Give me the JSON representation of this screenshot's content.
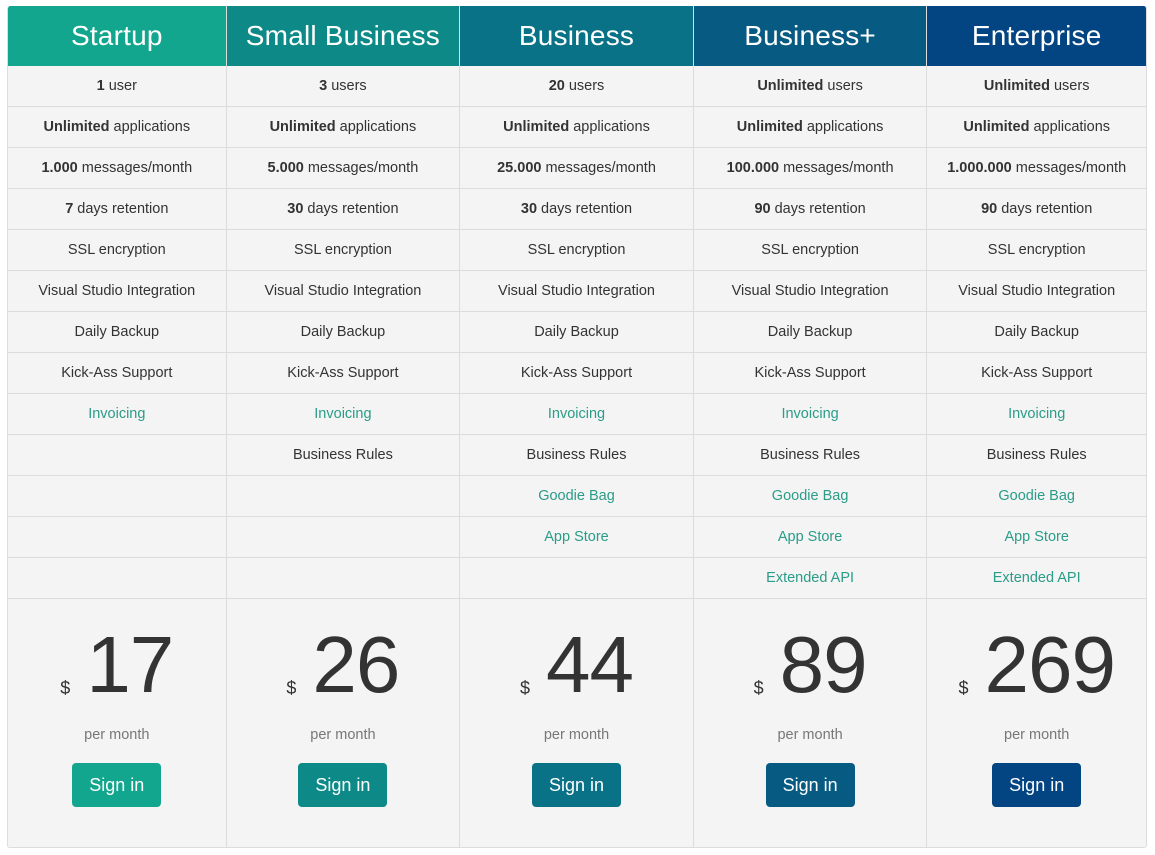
{
  "plans": [
    {
      "name": "Startup",
      "color": "#13a68e",
      "features": [
        {
          "bold": "1",
          "text": "user",
          "extra": false
        },
        {
          "bold": "Unlimited",
          "text": "applications",
          "extra": false
        },
        {
          "bold": "1.000",
          "text": "messages/month",
          "extra": false
        },
        {
          "bold": "7",
          "text": "days retention",
          "extra": false
        },
        {
          "bold": "",
          "text": "SSL encryption",
          "extra": false
        },
        {
          "bold": "",
          "text": "Visual Studio Integration",
          "extra": false
        },
        {
          "bold": "",
          "text": "Daily Backup",
          "extra": false
        },
        {
          "bold": "",
          "text": "Kick-Ass Support",
          "extra": false
        },
        {
          "bold": "",
          "text": "Invoicing",
          "extra": true
        },
        {
          "bold": "",
          "text": "",
          "extra": false
        },
        {
          "bold": "",
          "text": "",
          "extra": false
        },
        {
          "bold": "",
          "text": "",
          "extra": false
        },
        {
          "bold": "",
          "text": "",
          "extra": false
        }
      ],
      "currency": "$",
      "price": "17",
      "period": "per month",
      "button": "Sign in"
    },
    {
      "name": "Small Business",
      "color": "#0d8a88",
      "features": [
        {
          "bold": "3",
          "text": "users",
          "extra": false
        },
        {
          "bold": "Unlimited",
          "text": "applications",
          "extra": false
        },
        {
          "bold": "5.000",
          "text": "messages/month",
          "extra": false
        },
        {
          "bold": "30",
          "text": "days retention",
          "extra": false
        },
        {
          "bold": "",
          "text": "SSL encryption",
          "extra": false
        },
        {
          "bold": "",
          "text": "Visual Studio Integration",
          "extra": false
        },
        {
          "bold": "",
          "text": "Daily Backup",
          "extra": false
        },
        {
          "bold": "",
          "text": "Kick-Ass Support",
          "extra": false
        },
        {
          "bold": "",
          "text": "Invoicing",
          "extra": true
        },
        {
          "bold": "",
          "text": "Business Rules",
          "extra": false
        },
        {
          "bold": "",
          "text": "",
          "extra": false
        },
        {
          "bold": "",
          "text": "",
          "extra": false
        },
        {
          "bold": "",
          "text": "",
          "extra": false
        }
      ],
      "currency": "$",
      "price": "26",
      "period": "per month",
      "button": "Sign in"
    },
    {
      "name": "Business",
      "color": "#0a7286",
      "features": [
        {
          "bold": "20",
          "text": "users",
          "extra": false
        },
        {
          "bold": "Unlimited",
          "text": "applications",
          "extra": false
        },
        {
          "bold": "25.000",
          "text": "messages/month",
          "extra": false
        },
        {
          "bold": "30",
          "text": "days retention",
          "extra": false
        },
        {
          "bold": "",
          "text": "SSL encryption",
          "extra": false
        },
        {
          "bold": "",
          "text": "Visual Studio Integration",
          "extra": false
        },
        {
          "bold": "",
          "text": "Daily Backup",
          "extra": false
        },
        {
          "bold": "",
          "text": "Kick-Ass Support",
          "extra": false
        },
        {
          "bold": "",
          "text": "Invoicing",
          "extra": true
        },
        {
          "bold": "",
          "text": "Business Rules",
          "extra": false
        },
        {
          "bold": "",
          "text": "Goodie Bag",
          "extra": true
        },
        {
          "bold": "",
          "text": "App Store",
          "extra": true
        },
        {
          "bold": "",
          "text": "",
          "extra": false
        }
      ],
      "currency": "$",
      "price": "44",
      "period": "per month",
      "button": "Sign in"
    },
    {
      "name": "Business+",
      "color": "#075b83",
      "features": [
        {
          "bold": "Unlimited",
          "text": "users",
          "extra": false
        },
        {
          "bold": "Unlimited",
          "text": "applications",
          "extra": false
        },
        {
          "bold": "100.000",
          "text": "messages/month",
          "extra": false
        },
        {
          "bold": "90",
          "text": "days retention",
          "extra": false
        },
        {
          "bold": "",
          "text": "SSL encryption",
          "extra": false
        },
        {
          "bold": "",
          "text": "Visual Studio Integration",
          "extra": false
        },
        {
          "bold": "",
          "text": "Daily Backup",
          "extra": false
        },
        {
          "bold": "",
          "text": "Kick-Ass Support",
          "extra": false
        },
        {
          "bold": "",
          "text": "Invoicing",
          "extra": true
        },
        {
          "bold": "",
          "text": "Business Rules",
          "extra": false
        },
        {
          "bold": "",
          "text": "Goodie Bag",
          "extra": true
        },
        {
          "bold": "",
          "text": "App Store",
          "extra": true
        },
        {
          "bold": "",
          "text": "Extended API",
          "extra": true
        }
      ],
      "currency": "$",
      "price": "89",
      "period": "per month",
      "button": "Sign in"
    },
    {
      "name": "Enterprise",
      "color": "#034482",
      "features": [
        {
          "bold": "Unlimited",
          "text": "users",
          "extra": false
        },
        {
          "bold": "Unlimited",
          "text": "applications",
          "extra": false
        },
        {
          "bold": "1.000.000",
          "text": "messages/month",
          "extra": false
        },
        {
          "bold": "90",
          "text": "days retention",
          "extra": false
        },
        {
          "bold": "",
          "text": "SSL encryption",
          "extra": false
        },
        {
          "bold": "",
          "text": "Visual Studio Integration",
          "extra": false
        },
        {
          "bold": "",
          "text": "Daily Backup",
          "extra": false
        },
        {
          "bold": "",
          "text": "Kick-Ass Support",
          "extra": false
        },
        {
          "bold": "",
          "text": "Invoicing",
          "extra": true
        },
        {
          "bold": "",
          "text": "Business Rules",
          "extra": false
        },
        {
          "bold": "",
          "text": "Goodie Bag",
          "extra": true
        },
        {
          "bold": "",
          "text": "App Store",
          "extra": true
        },
        {
          "bold": "",
          "text": "Extended API",
          "extra": true
        }
      ],
      "currency": "$",
      "price": "269",
      "period": "per month",
      "button": "Sign in"
    }
  ],
  "accent_color": "#2a9c88"
}
